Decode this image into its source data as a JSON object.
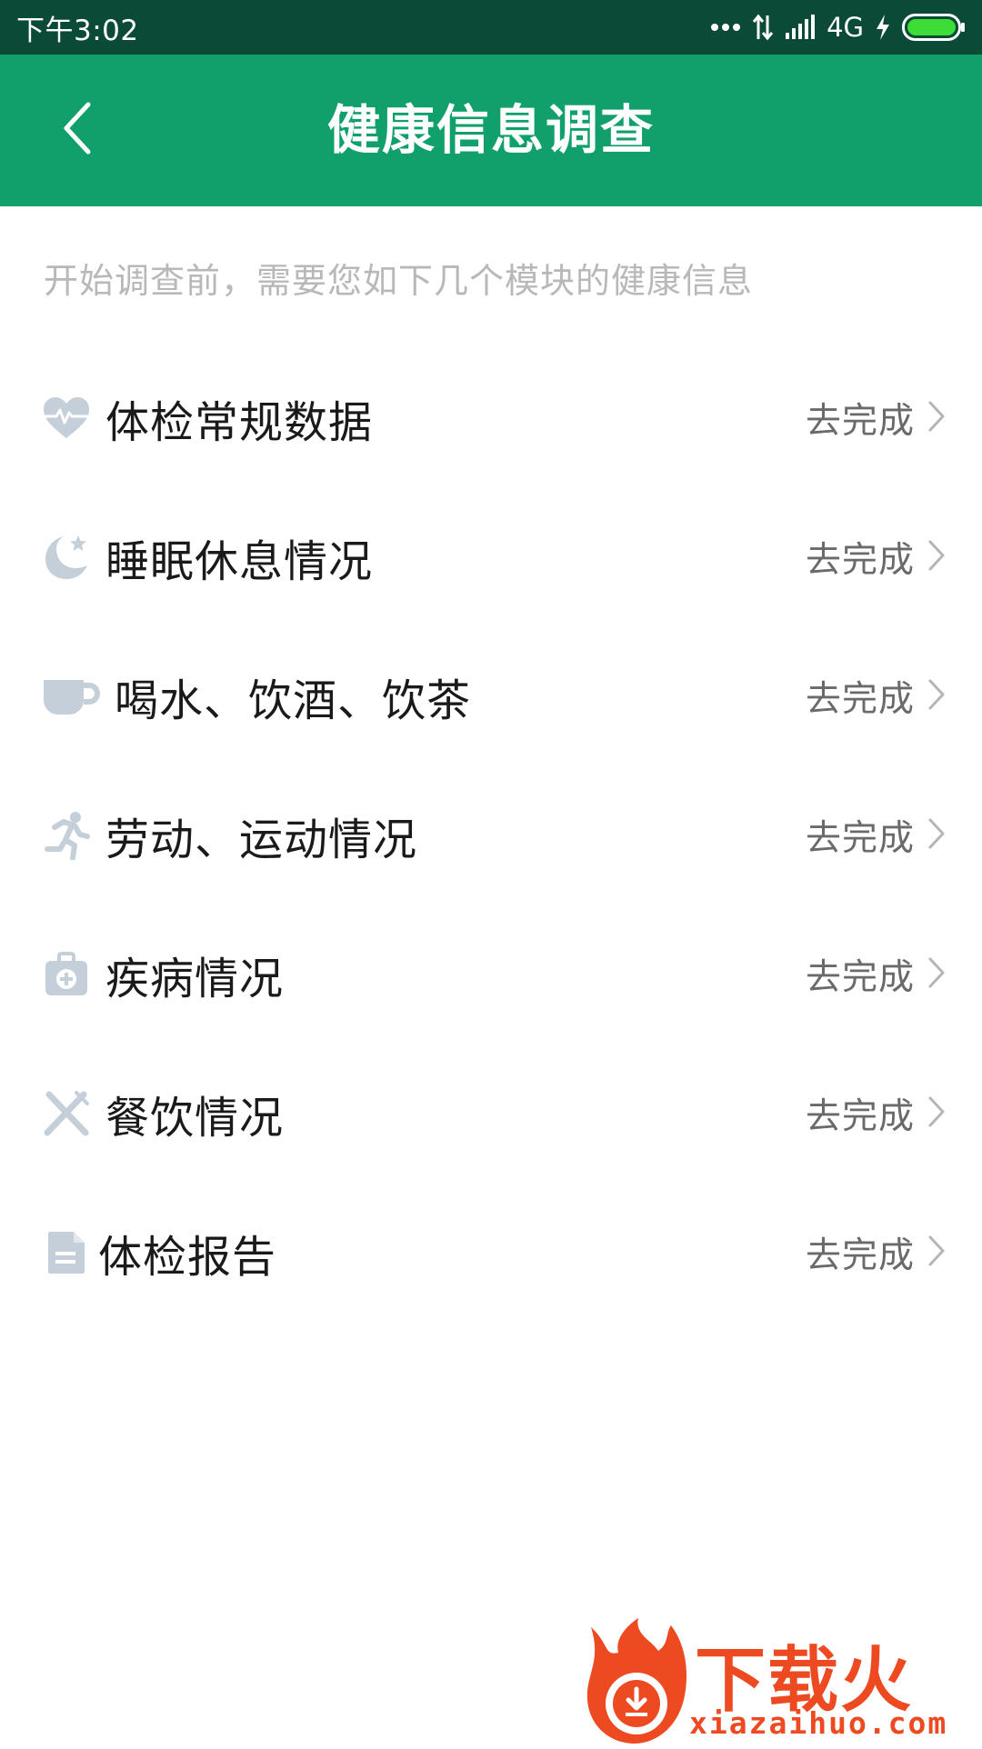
{
  "status_bar": {
    "time": "下午3:02",
    "network": "4G",
    "icons": [
      "more-dots-icon",
      "data-arrows-icon",
      "signal-icon",
      "charging-icon",
      "battery-icon"
    ]
  },
  "header": {
    "title": "健康信息调查",
    "back_icon": "chevron-left-icon"
  },
  "intro": {
    "text": "开始调查前，需要您如下几个模块的健康信息"
  },
  "modules": [
    {
      "icon": "heart-pulse-icon",
      "label": "体检常规数据",
      "action": "去完成"
    },
    {
      "icon": "moon-star-icon",
      "label": "睡眠休息情况",
      "action": "去完成"
    },
    {
      "icon": "cup-icon",
      "label": "喝水、饮酒、饮茶",
      "action": "去完成"
    },
    {
      "icon": "running-icon",
      "label": "劳动、运动情况",
      "action": "去完成"
    },
    {
      "icon": "medical-kit-icon",
      "label": "疾病情况",
      "action": "去完成"
    },
    {
      "icon": "fork-knife-icon",
      "label": "餐饮情况",
      "action": "去完成"
    },
    {
      "icon": "document-icon",
      "label": "体检报告",
      "action": "去完成"
    }
  ],
  "watermark": {
    "brand": "下载火",
    "url": "xiazaihuo.com"
  },
  "colors": {
    "status_bar": "#0a4a36",
    "header": "#11a06c",
    "icon_gray": "#c5cfd9",
    "hint_text": "#b8b8b8",
    "watermark": "#ee4a22"
  }
}
